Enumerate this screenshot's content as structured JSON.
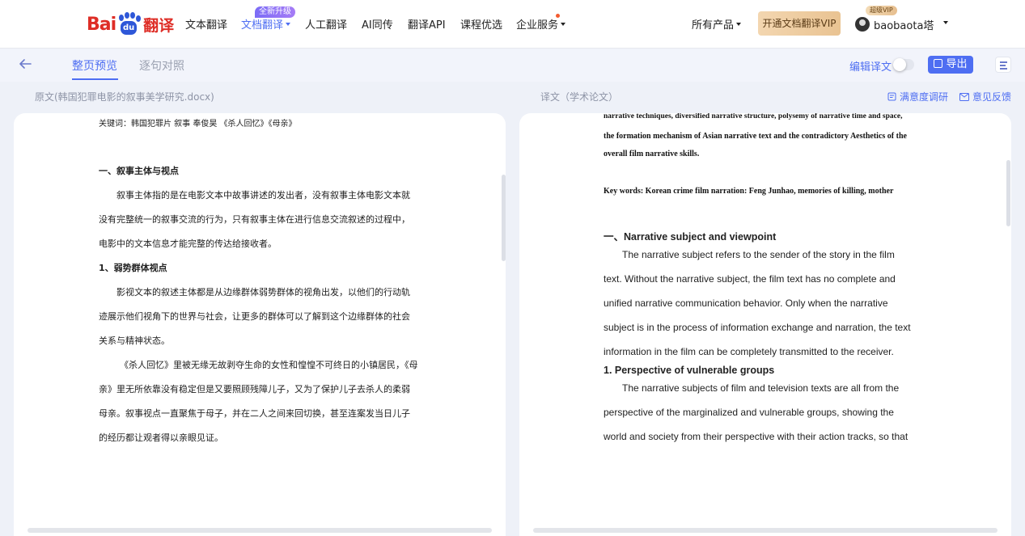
{
  "nav": {
    "items": [
      "文本翻译",
      "文档翻译",
      "人工翻译",
      "AI同传",
      "翻译API",
      "课程优选",
      "企业服务"
    ],
    "new_badge": "全新升级",
    "all_products": "所有产品",
    "vip_button": "开通文档翻译VIP",
    "svip_badge": "超级VIP",
    "username": "baobaota塔"
  },
  "logo": {
    "bai": "Bai",
    "du": "du",
    "fanyi": "翻译"
  },
  "tabs": {
    "page_preview": "整页预览",
    "sentence_compare": "逐句对照",
    "edit_translation": "编辑译文",
    "export": "导出"
  },
  "headers": {
    "source": "原文(韩国犯罪电影的叙事美学研究.docx)",
    "target": "译文（学术论文）",
    "survey": "满意度调研",
    "feedback": "意见反馈"
  },
  "source_doc": {
    "keywords_cut": "关键词：韩国犯罪片 叙事 奉俊昊 《杀人回忆》《母亲》",
    "heading1": "一、叙事主体与视点",
    "p1_lines": [
      "叙事主体指的是在电影文本中故事讲述的发出者，没有叙事主体电影文本就",
      "没有完整统一的叙事交流的行为，只有叙事主体在进行信息交流叙述的过程中，",
      "电影中的文本信息才能完整的传达给接收者。"
    ],
    "heading2": "1、弱势群体视点",
    "p2_lines": [
      "影视文本的叙述主体都是从边缘群体弱势群体的视角出发，以他们的行动轨",
      "迹展示他们视角下的世界与社会，让更多的群体可以了解到这个边缘群体的社会",
      "关系与精神状态。"
    ],
    "p3_lines": [
      "《杀人回忆》里被无缘无故剥夺生命的女性和惶惶不可终日的小镇居民，《母",
      "亲》里无所依靠没有稳定但是又要照顾残障儿子，又为了保护儿子去杀人的柔弱",
      "母亲。叙事视点一直聚焦于母子，并在二人之间来回切换，甚至连案发当日儿子",
      "的经历都让观者得以亲眼见证。"
    ]
  },
  "target_doc": {
    "abstract_cut": "narrative techniques, diversified narrative structure, polysemy of narrative time and space,",
    "abstract_lines": [
      "the formation mechanism of Asian narrative text and the contradictory Aesthetics of the",
      "overall film narrative skills."
    ],
    "keywords": "Key words: Korean crime film narration: Feng Junhao, memories of killing, mother",
    "heading1": "一、Narrative subject and viewpoint",
    "p1_lines": [
      "The narrative subject refers to the sender of the story in the film",
      "text. Without the narrative subject, the film text has no complete and",
      "unified narrative communication behavior. Only when the narrative",
      "subject is in the process of information exchange and narration, the text",
      "information in the film can be completely transmitted to the receiver."
    ],
    "heading2": "1. Perspective of vulnerable groups",
    "p2_lines": [
      "The narrative subjects of film and television texts are all from the",
      "perspective of the marginalized and vulnerable groups, showing the",
      "world and society from their perspective with their action tracks, so that"
    ]
  }
}
